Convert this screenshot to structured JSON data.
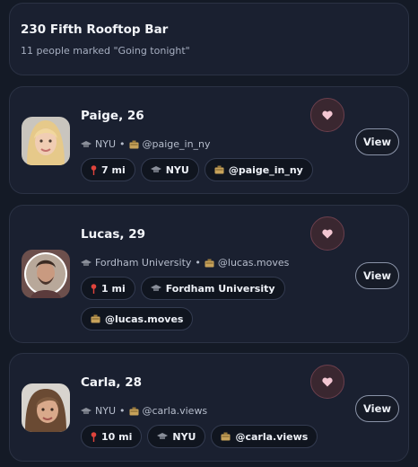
{
  "venue": {
    "title": "230 Fifth Rooftop Bar",
    "subtitle": "11 people marked \"Going tonight\""
  },
  "people": [
    {
      "name": "Paige, 26",
      "school": "NYU",
      "separator": "•",
      "handle": "@paige_in_ny",
      "chips": [
        "7 mi",
        "NYU",
        "@paige_in_ny"
      ],
      "view_label": "View"
    },
    {
      "name": "Lucas, 29",
      "school": "Fordham University",
      "separator": "•",
      "handle": "@lucas.moves",
      "chips": [
        "1 mi",
        "Fordham University",
        "@lucas.moves"
      ],
      "view_label": "View"
    },
    {
      "name": "Carla, 28",
      "school": "NYU",
      "separator": "•",
      "handle": "@carla.views",
      "chips": [
        "10 mi",
        "NYU",
        "@carla.views"
      ],
      "view_label": "View"
    }
  ],
  "icons": {
    "heart": "heart-icon",
    "pin": "map-pin-icon",
    "school": "graduation-cap-icon",
    "handle": "camera-icon"
  },
  "colors": {
    "background": "#141a26",
    "card": "#1a2030",
    "heart": "#f3c6d2",
    "pin": "#e0443c"
  }
}
